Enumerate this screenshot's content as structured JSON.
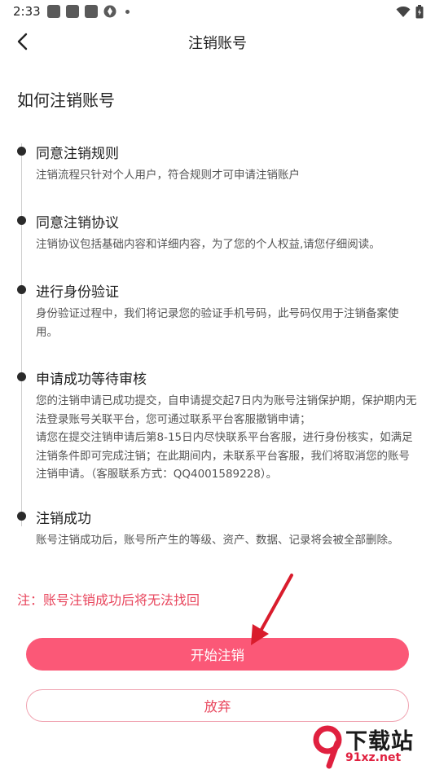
{
  "status_bar": {
    "time": "2:33",
    "icons_left": [
      "app-icon",
      "app-icon",
      "app-icon",
      "aperture-icon"
    ],
    "icons_right": [
      "wifi-icon",
      "battery-icon"
    ]
  },
  "nav": {
    "title": "注销账号",
    "back_icon": "chevron-left-icon"
  },
  "heading": "如何注销账号",
  "steps": [
    {
      "title": "同意注销规则",
      "desc": "注销流程只针对个人用户，符合规则才可申请注销账户"
    },
    {
      "title": "同意注销协议",
      "desc": "注销协议包括基础内容和详细内容，为了您的个人权益,请您仔细阅读。"
    },
    {
      "title": "进行身份验证",
      "desc": "身份验证过程中，我们将记录您的验证手机号码，此号码仅用于注销备案使用。"
    },
    {
      "title": "申请成功等待审核",
      "desc": "您的注销申请已成功提交，自申请提交起7日内为账号注销保护期，保护期内无法登录账号关联平台，您可通过联系平台客服撤销申请；\n请您在提交注销申请后第8-15日内尽快联系平台客服，进行身份核实，如满足注销条件即可完成注销；在此期间内，未联系平台客服，我们将取消您的账号注销申请。（客服联系方式：QQ4001589228）。"
    },
    {
      "title": "注销成功",
      "desc": "账号注销成功后，账号所产生的等级、资产、数据、记录将会被全部删除。"
    }
  ],
  "note": "注：账号注销成功后将无法找回",
  "buttons": {
    "start_label": "开始注销",
    "abandon_label": "放弃"
  },
  "colors": {
    "primary": "#fb5877",
    "note_red": "#e8455c",
    "outline": "#f0a2b0"
  },
  "watermark": {
    "title": "下载站",
    "url": "91xz.net"
  }
}
